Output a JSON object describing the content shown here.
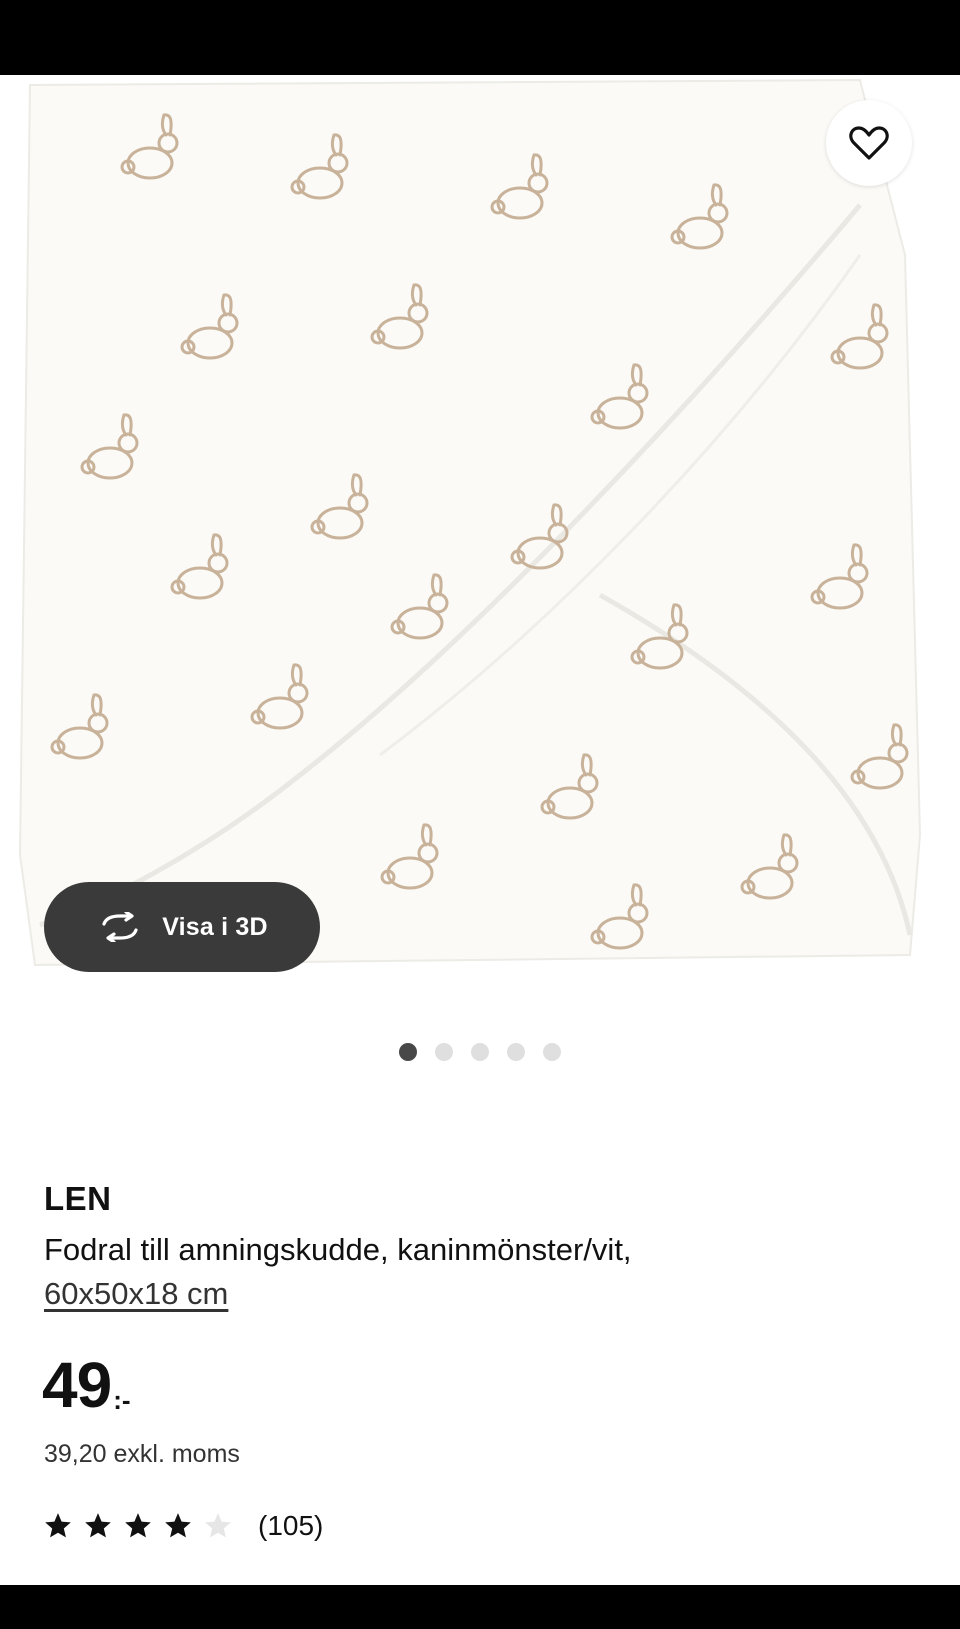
{
  "product": {
    "name": "LEN",
    "description": "Fodral till amningskudde, kaninmönster/vit,",
    "size": "60x50x18 cm"
  },
  "price": {
    "main": "49",
    "suffix": ":-",
    "excl_vat": "39,20 exkl. moms"
  },
  "rating": {
    "value": 4,
    "max": 5,
    "reviews": "(105)"
  },
  "gallery": {
    "view_3d_label": "Visa i 3D",
    "slide_count": 5,
    "active_slide": 1
  },
  "icons": {
    "favorite": "heart-icon",
    "view_3d": "rotate-icon",
    "star": "star-icon"
  },
  "colors": {
    "pill_background": "#3a3a3a",
    "dot_active": "#484848",
    "dot_inactive": "#dfdfdf",
    "fabric": "#fbfaf6",
    "pattern": "#c9b29a"
  }
}
